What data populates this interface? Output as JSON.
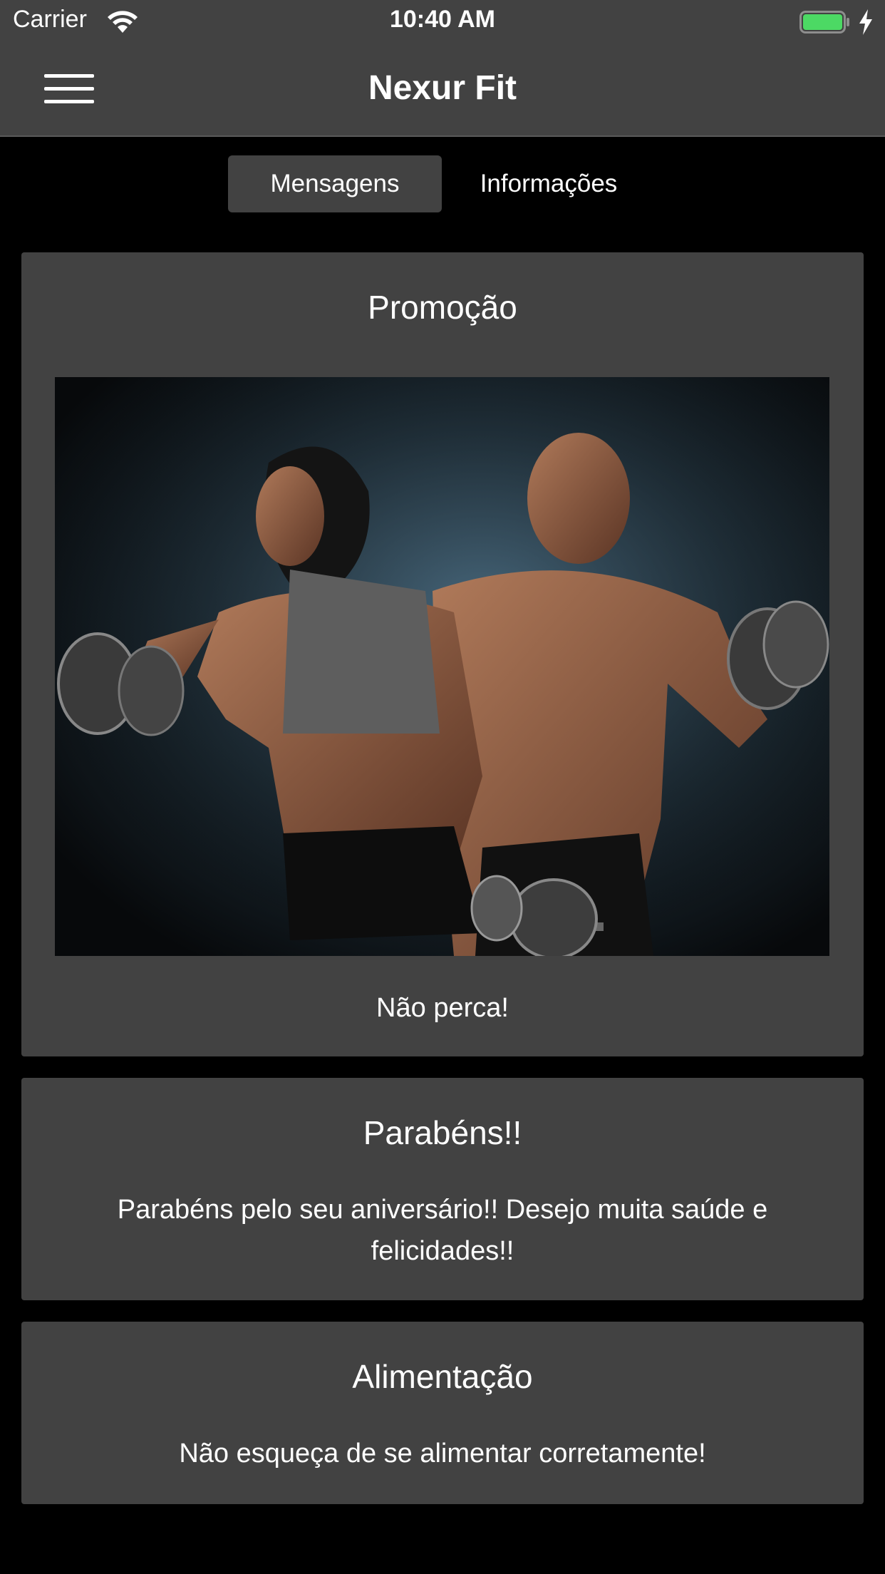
{
  "status_bar": {
    "carrier": "Carrier",
    "time": "10:40 AM",
    "battery_color": "#4cd964"
  },
  "nav": {
    "title": "Nexur Fit"
  },
  "tabs": [
    {
      "label": "Mensagens",
      "active": true
    },
    {
      "label": "Informações",
      "active": false
    }
  ],
  "cards": [
    {
      "title": "Promoção",
      "body": "Não perca!",
      "has_image": true
    },
    {
      "title": "Parabéns!!",
      "body": "Parabéns pelo seu aniversário!! Desejo muita saúde e felicidades!!"
    },
    {
      "title": "Alimentação",
      "body": "Não esqueça de se alimentar corretamente!"
    }
  ],
  "colors": {
    "background": "#000000",
    "bar": "#424242",
    "card": "#424242",
    "text": "#ffffff"
  }
}
